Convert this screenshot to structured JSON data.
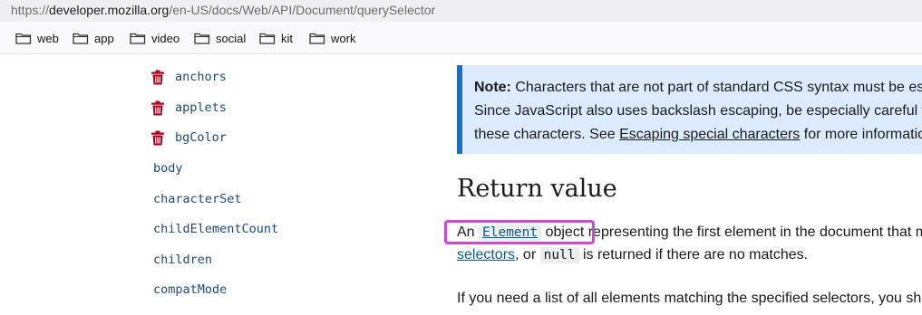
{
  "browser": {
    "url_scheme": "https://",
    "url_host": "developer.mozilla.org",
    "url_path": "/en-US/docs/Web/API/Document/querySelector"
  },
  "bookmarks": [
    {
      "label": "web",
      "icon": "folder-icon"
    },
    {
      "label": "app",
      "icon": "folder-icon"
    },
    {
      "label": "video",
      "icon": "folder-icon"
    },
    {
      "label": "social",
      "icon": "folder-icon"
    },
    {
      "label": "kit",
      "icon": "folder-icon"
    },
    {
      "label": "work",
      "icon": "folder-icon"
    }
  ],
  "sidebar": {
    "items": [
      {
        "label": "anchors",
        "deprecated": true
      },
      {
        "label": "applets",
        "deprecated": true
      },
      {
        "label": "bgColor",
        "deprecated": true
      },
      {
        "label": "body",
        "deprecated": false
      },
      {
        "label": "characterSet",
        "deprecated": false
      },
      {
        "label": "childElementCount",
        "deprecated": false
      },
      {
        "label": "children",
        "deprecated": false
      },
      {
        "label": "compatMode",
        "deprecated": false
      }
    ]
  },
  "note": {
    "label": "Note:",
    "line1": " Characters that are not part of standard CSS syntax must be esc",
    "line2": "Since JavaScript also uses backslash escaping, be especially careful w",
    "line3_pre": "these characters. See ",
    "link": "Escaping special characters",
    "line3_post": " for more informatio"
  },
  "return_value": {
    "heading": "Return value",
    "p1_pre": "An ",
    "p1_code": "Element",
    "p1_post": " object representing the first element in the document that m",
    "p2_link": "selectors",
    "p2_mid": ", or ",
    "p2_code": "null",
    "p2_post": " is returned if there are no matches.",
    "p3": "If you need a list of all elements matching the specified selectors, you sho"
  },
  "colors": {
    "highlight": "#d048d6",
    "deprecated_icon": "#b3001e",
    "note_bg": "#dbeafc",
    "note_border": "#1a6ec7",
    "link": "#0a5b8c"
  }
}
